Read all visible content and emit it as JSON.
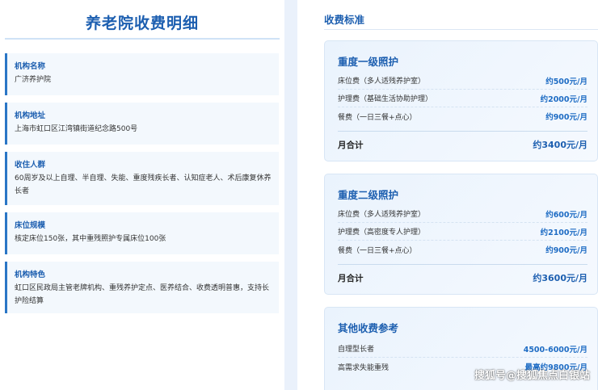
{
  "left": {
    "title": "养老院收费明细",
    "items": [
      {
        "label": "机构名称",
        "value": "广济养护院"
      },
      {
        "label": "机构地址",
        "value": "上海市虹口区江湾镇街道纪念路500号"
      },
      {
        "label": "收住人群",
        "value": "60周岁及以上自理、半自理、失能、重度残疾长者、认知症老人、术后康复休养长者"
      },
      {
        "label": "床位规模",
        "value": "核定床位150张，其中重残照护专属床位100张"
      },
      {
        "label": "机构特色",
        "value": "虹口区民政局主管老牌机构、重残养护定点、医养结合、收费透明普惠，支持长护险结算"
      }
    ]
  },
  "right": {
    "title": "收费标准",
    "cards": [
      {
        "title": "重度一级照护",
        "rows": [
          {
            "name": "床位费（多人适残养护室）",
            "price": "约500元/月"
          },
          {
            "name": "护理费（基础生活协助护理）",
            "price": "约2000元/月"
          },
          {
            "name": "餐费（一日三餐+点心）",
            "price": "约900元/月"
          }
        ],
        "total_label": "月合计",
        "total_value": "约3400元/月"
      },
      {
        "title": "重度二级照护",
        "rows": [
          {
            "name": "床位费（多人适残养护室）",
            "price": "约600元/月"
          },
          {
            "name": "护理费（高密度专人护理）",
            "price": "约2100元/月"
          },
          {
            "name": "餐费（一日三餐+点心）",
            "price": "约900元/月"
          }
        ],
        "total_label": "月合计",
        "total_value": "约3600元/月"
      },
      {
        "title": "其他收费参考",
        "rows": [
          {
            "name": "自理型长者",
            "price": "4500-6000元/月"
          },
          {
            "name": "高需求失能重残",
            "price": "最高约9800元/月"
          }
        ]
      }
    ]
  },
  "watermark": "搜狐号@搜狐焦点白银站",
  "colors": {
    "accent": "#1d5fb0",
    "price": "#1e6cc4",
    "background": "#eaf1fb"
  }
}
